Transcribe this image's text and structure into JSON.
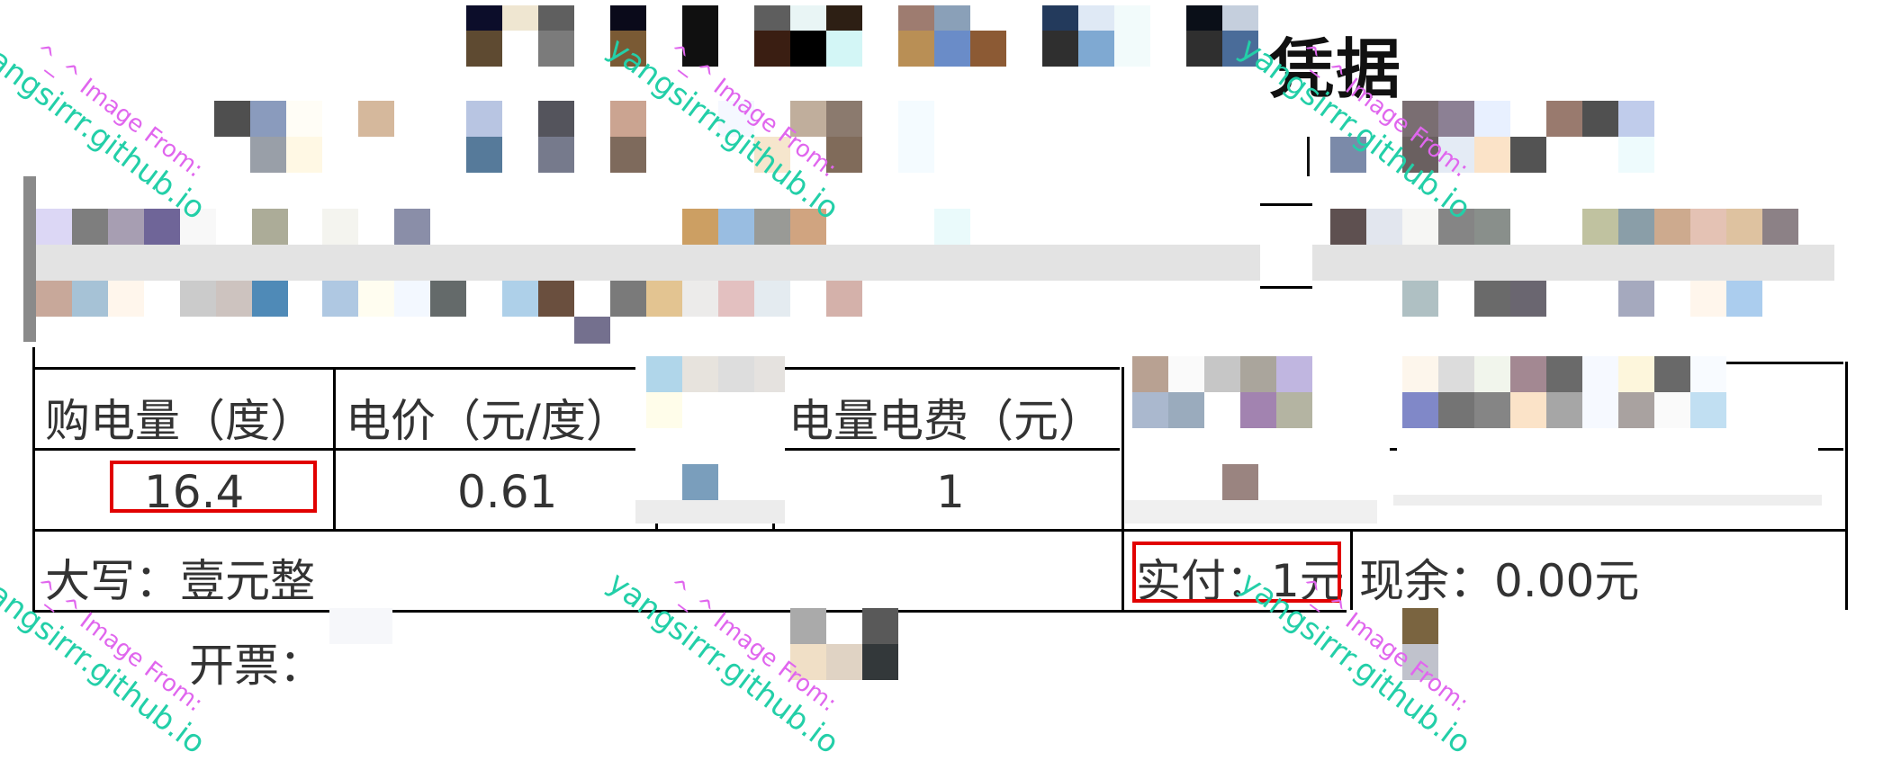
{
  "title_fragment": "凭据",
  "table": {
    "headers": [
      "购电量（度）",
      "电价（元/度）",
      "电量电费（元）"
    ],
    "values": [
      "16.4",
      "0.61",
      "1"
    ]
  },
  "footer": {
    "amount_in_words": "大写：壹元整",
    "paid": "实付：1元",
    "balance": "现余：0.00元",
    "invoice": "开票："
  },
  "watermark": {
    "line1": "^_^ Image From:",
    "line2": "yangsirrr.github.io"
  },
  "colors": {
    "highlight_border": "#e10000",
    "watermark_pink": "#e066ee",
    "watermark_teal": "#23cfa8"
  }
}
